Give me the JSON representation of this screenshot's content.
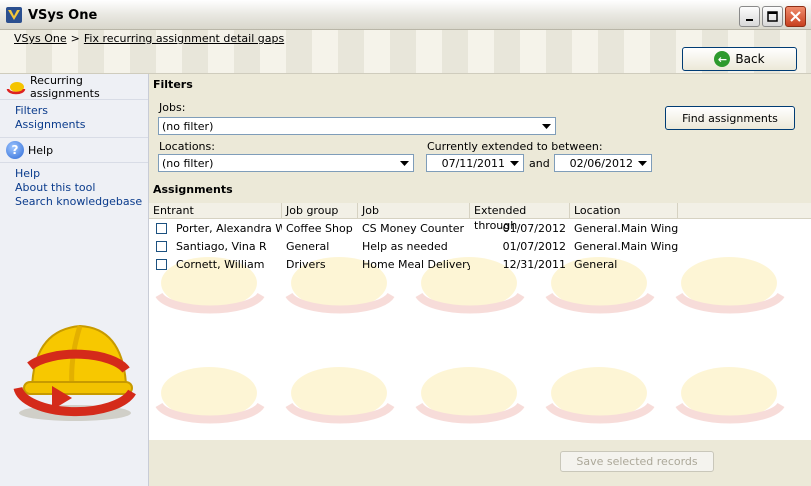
{
  "window": {
    "title": "VSys One"
  },
  "breadcrumb": {
    "root": "VSys One",
    "separator": ">",
    "current": "Fix recurring assignment detail gaps"
  },
  "toolbar": {
    "back_label": "Back"
  },
  "sidebar": {
    "section_recurring": "Recurring assignments",
    "nav": [
      {
        "label": "Filters"
      },
      {
        "label": "Assignments"
      }
    ],
    "section_help": "Help",
    "help_links": [
      {
        "label": "Help"
      },
      {
        "label": "About this tool"
      },
      {
        "label": "Search knowledgebase"
      }
    ]
  },
  "filters": {
    "title": "Filters",
    "jobs_label": "Jobs:",
    "jobs_value": "(no filter)",
    "locations_label": "Locations:",
    "locations_value": "(no filter)",
    "extended_label": "Currently extended to between:",
    "date_from": "07/11/2011",
    "and_label": "and",
    "date_to": "02/06/2012",
    "find_label": "Find assignments"
  },
  "assignments": {
    "title": "Assignments",
    "columns": [
      "Entrant",
      "Job group",
      "Job",
      "Extended through",
      "Location"
    ],
    "rows": [
      {
        "entrant": "Porter, Alexandra W",
        "group": "Coffee Shop",
        "job": "CS Money Counter",
        "extended": "01/07/2012",
        "location": "General.Main Wing"
      },
      {
        "entrant": "Santiago, Vina R",
        "group": "General",
        "job": "Help as needed",
        "extended": "01/07/2012",
        "location": "General.Main Wing"
      },
      {
        "entrant": "Cornett, William",
        "group": "Drivers",
        "job": "Home Meal Delivery",
        "extended": "12/31/2011",
        "location": "General"
      }
    ],
    "save_label": "Save selected records"
  }
}
